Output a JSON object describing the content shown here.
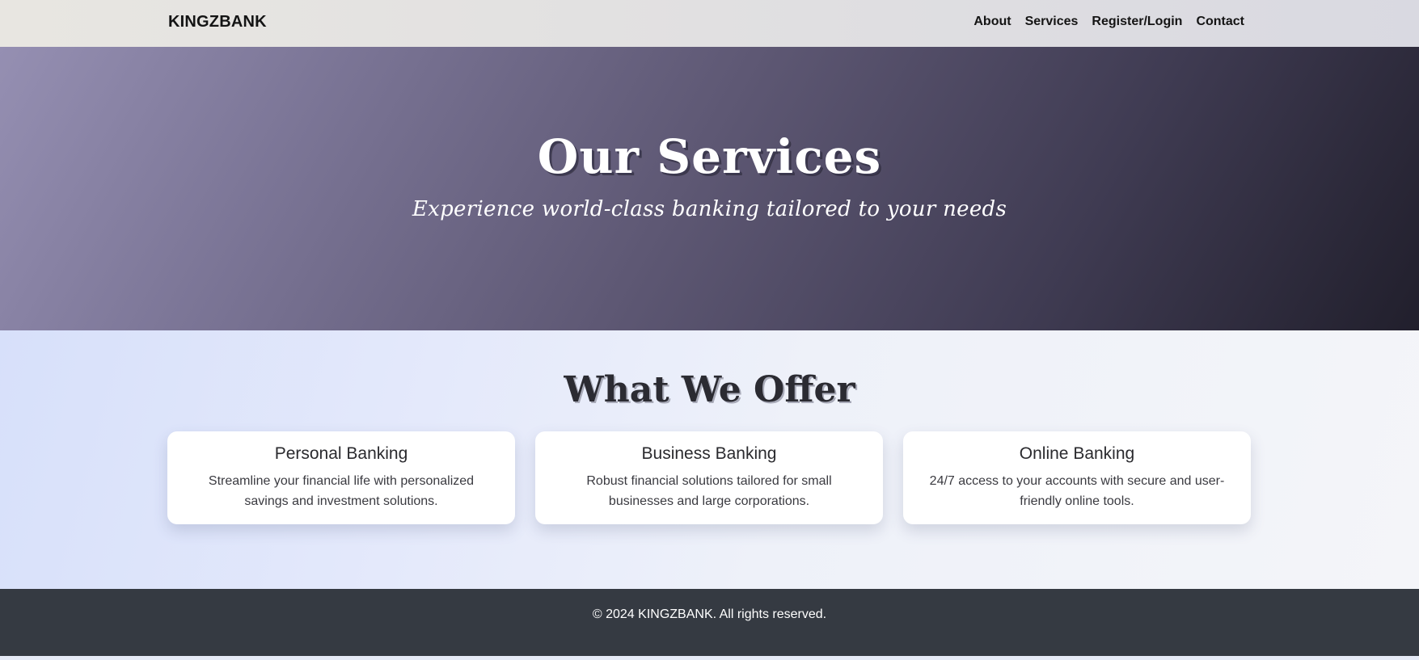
{
  "navbar": {
    "brand": "KINGZBANK",
    "links": [
      "About",
      "Services",
      "Register/Login",
      "Contact"
    ]
  },
  "hero": {
    "title": "Our Services",
    "subtitle": "Experience world-class banking tailored to your needs"
  },
  "offer": {
    "title": "What We Offer",
    "cards": [
      {
        "title": "Personal Banking",
        "text": "Streamline your financial life with personalized savings and investment solutions."
      },
      {
        "title": "Business Banking",
        "text": "Robust financial solutions tailored for small businesses and large corporations."
      },
      {
        "title": "Online Banking",
        "text": "24/7 access to your accounts with secure and user-friendly online tools."
      }
    ]
  },
  "footer": {
    "copyright": "© 2024 KINGZBANK. All rights reserved."
  }
}
